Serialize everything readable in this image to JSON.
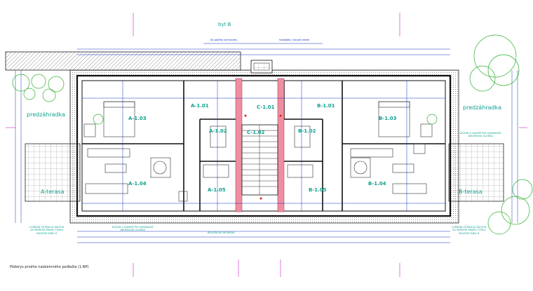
{
  "drawing": {
    "apartment_label": "byt B",
    "caption": "Pôdorys prvého nadzemného podlažia (1.NP)",
    "dim_top": "Sa políčka schrubnes",
    "dim_top2": "Vsadadlo / dovod vstroh"
  },
  "rooms": {
    "a101": "A-1.01",
    "a102": "A-1.02",
    "a103": "A-1.03",
    "a104": "A-1.04",
    "a105": "A-1.05",
    "b101": "B-1.01",
    "b102": "B-1.02",
    "b103": "B-1.03",
    "b104": "B-1.04",
    "b105": "B-1.05",
    "c101": "C-1.01",
    "c102": "C-1.02"
  },
  "areas": {
    "left_garden": "predzáhradka",
    "right_garden": "predzáhradka",
    "left_terrace": "A-terasa",
    "right_terrace": "B-terasa"
  },
  "notes": {
    "left_bottom": "LOMENÁ VETRACIA ŠÁCHTA\nZA ŠIRÍKOM ŠRAKO TORLA\nMALTOM MIKU H",
    "right_bottom": "LOMENÁ VETRACIA ŠÁCHTA\nZA ŠIRÍKOM ŠRAKO TORLA\nMALTOM MIKU H",
    "right_top": "KOZUB S IZAVRETÝM OHNISKOM\nAKUSNOVÁ VLOŽKA",
    "mid_left": "KOZUB S IZAVRETÝM OHNISKOM\nAKUSNOVÁ VLOŽKA",
    "mid_center": "BELATAČIA ŠÁCHODA"
  },
  "colors": {
    "wall": "#101010",
    "dimension": "#1030c0",
    "annotation": "#10a090",
    "axis": "#d020c0",
    "stair": "#ee8ea0",
    "tree": "#30b030"
  }
}
